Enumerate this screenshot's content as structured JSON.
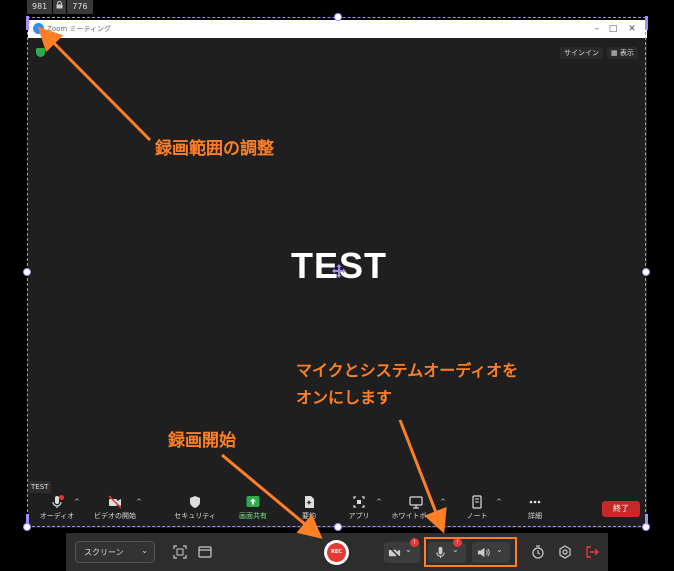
{
  "size_badge": {
    "width": "981",
    "lock_icon": "lock-icon",
    "height": "776"
  },
  "zoom_window": {
    "title": "Zoom ミーティング",
    "signin_label": "サインイン",
    "view_label": "表示",
    "content_text": "TEST",
    "self_label": "TEST",
    "toolbar": [
      {
        "label": "オーディオ",
        "icon": "microphone-icon"
      },
      {
        "label": "ビデオの開始",
        "icon": "video-off-icon"
      },
      {
        "label": "セキュリティ",
        "icon": "shield-icon"
      },
      {
        "label": "画面共有",
        "icon": "share-screen-icon"
      },
      {
        "label": "要約",
        "icon": "summary-icon"
      },
      {
        "label": "アプリ",
        "icon": "apps-icon"
      },
      {
        "label": "ホワイトボード",
        "icon": "whiteboard-icon"
      },
      {
        "label": "ノート",
        "icon": "notes-icon"
      },
      {
        "label": "詳細",
        "icon": "more-icon"
      }
    ],
    "end_label": "終了",
    "audio_badge": "!"
  },
  "recorder_bar": {
    "capture_mode": "スクリーン",
    "rec_label": "REC",
    "camera_badge": "!",
    "mic_badge": "!"
  },
  "annotations": {
    "adjust_range": "録画範囲の調整",
    "mic_system_line1": "マイクとシステムオーディオを",
    "mic_system_line2": "オンにします",
    "start_recording": "録画開始"
  },
  "colors": {
    "annotation": "#ff7f27",
    "selection": "#a68cff",
    "record": "#e53935",
    "end_button": "#c62828"
  }
}
